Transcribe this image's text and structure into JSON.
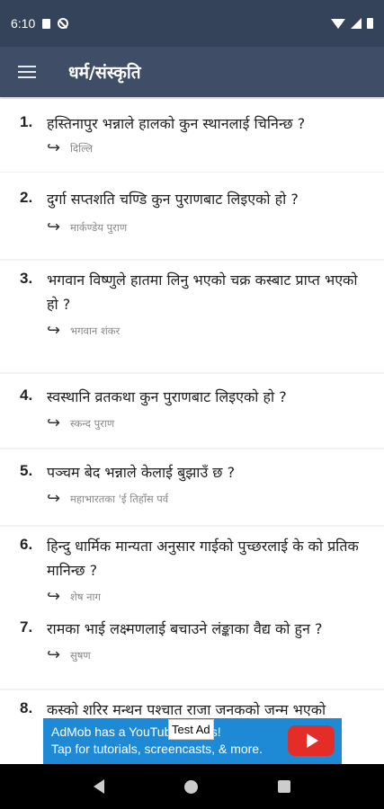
{
  "status_bar": {
    "time": "6:10"
  },
  "app_bar": {
    "title": "धर्म/संस्कृति",
    "menu_icon": "hamburger-menu-icon"
  },
  "questions": [
    {
      "num": "1.",
      "text": "हस्तिनापुर भन्नाले हालको कुन स्थानलाई चिनिन्छ ?",
      "answer": "दिल्लि"
    },
    {
      "num": "2.",
      "text": "दुर्गा सप्तशति चण्डि कुन पुराणबाट लिइएको हो ?",
      "answer": "मार्कण्डेय पुराण"
    },
    {
      "num": "3.",
      "text": "भगवान विष्णुले हातमा लिनु भएको चक्र कस्बाट प्राप्त भएको हो ?",
      "answer": "भगवान शंकर"
    },
    {
      "num": "4.",
      "text": "स्वस्थानि व्रतकथा कुन पुराणबाट लिइएको हो ?",
      "answer": "स्कन्द पुराण"
    },
    {
      "num": "5.",
      "text": "पञ्चम बेद भन्नाले केलाई बुझाउँ छ ?",
      "answer": "महाभारतका 'ई तिहाँस पर्व"
    },
    {
      "num": "6.",
      "text": "हिन्दु धार्मिक मान्यता अनुसार गाईको पुच्छरलाई के को प्रतिक मानिन्छ ?",
      "answer": "शेष नाग"
    },
    {
      "num": "7.",
      "text": "रामका भाई लक्ष्मणलाई बचाउने लंङ्काका वैद्य को हुन ?",
      "answer": "सुषण"
    },
    {
      "num": "8.",
      "text": "कस्को शरिर मन्थन पश्चात राजा जनकको जन्म भएको",
      "answer": ""
    }
  ],
  "ad": {
    "line1": "AdMob has a YouTube Series!",
    "line2": "Tap for tutorials, screencasts, & more.",
    "label": "Test Ad"
  }
}
